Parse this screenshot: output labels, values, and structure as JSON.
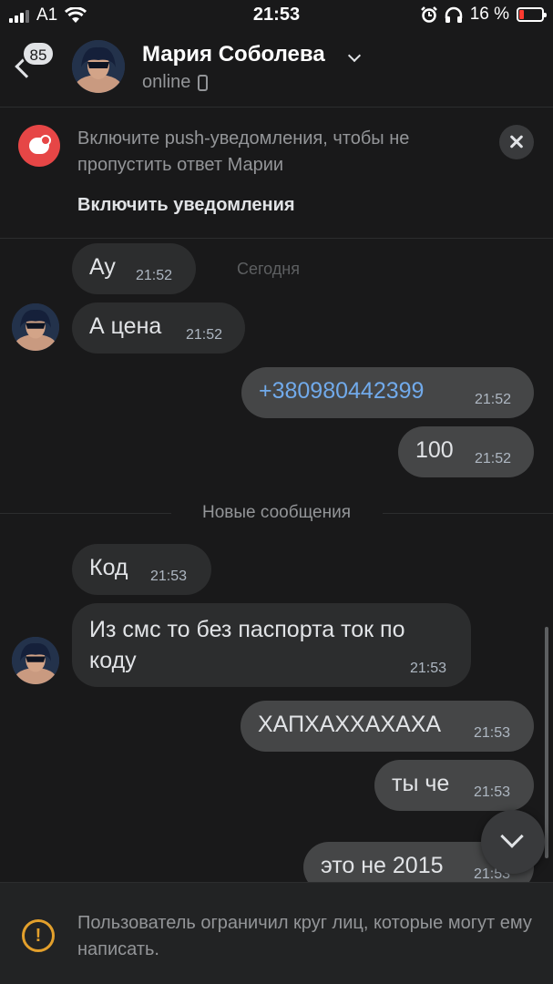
{
  "status_bar": {
    "carrier": "A1",
    "time": "21:53",
    "battery": "16 %"
  },
  "header": {
    "unread_count": "85",
    "contact_name": "Мария Соболева",
    "presence": "online"
  },
  "push_banner": {
    "text": "Включите push-уведомления, чтобы не пропустить ответ Марии",
    "action_label": "Включить уведомления"
  },
  "chat": {
    "date_label": "Сегодня",
    "new_messages_label": "Новые сообщения",
    "messages": [
      {
        "text": "Ау",
        "time": "21:52",
        "direction": "in"
      },
      {
        "text": "А цена",
        "time": "21:52",
        "direction": "in"
      },
      {
        "text": "+380980442399",
        "time": "21:52",
        "direction": "out"
      },
      {
        "text": "100",
        "time": "21:52",
        "direction": "out"
      },
      {
        "text": "Код",
        "time": "21:53",
        "direction": "in"
      },
      {
        "text": "Из смс то без паспорта ток по\nкоду",
        "time": "21:53",
        "direction": "in"
      },
      {
        "text": "ХАПХАХХАХАХА",
        "time": "21:53",
        "direction": "out"
      },
      {
        "text": "ты че",
        "time": "21:53",
        "direction": "out"
      },
      {
        "text": "это не 2015",
        "time": "21:53",
        "direction": "out"
      }
    ]
  },
  "restriction_notice": {
    "text": "Пользователь ограничил круг лиц, которые могут ему написать."
  },
  "colors": {
    "background": "#19191a",
    "incoming_bubble": "#2c2d2e",
    "outgoing_bubble": "#454647",
    "link": "#71aaeb",
    "push_icon": "#e64646",
    "warning": "#e3a02c"
  }
}
